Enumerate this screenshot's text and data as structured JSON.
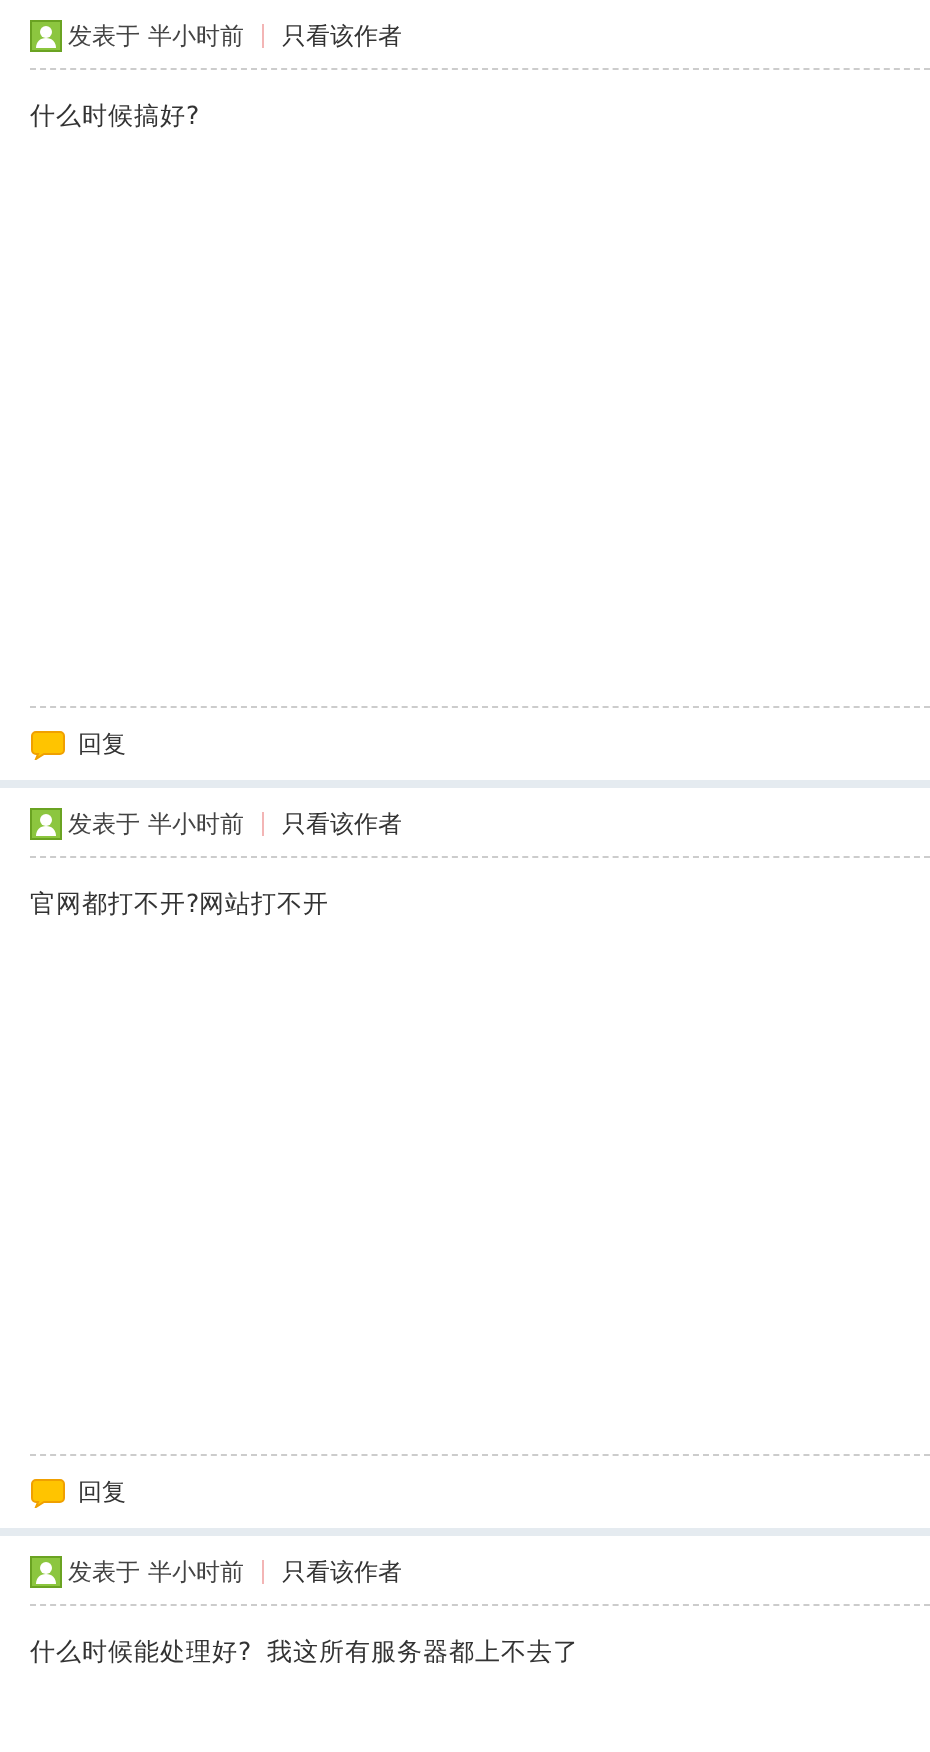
{
  "posts": [
    {
      "posted_label": "发表于",
      "time": "半小时前",
      "author_only_link": "只看该作者",
      "content": "什么时候搞好?",
      "reply_link": "回复"
    },
    {
      "posted_label": "发表于",
      "time": "半小时前",
      "author_only_link": "只看该作者",
      "content": "官网都打不开?网站打不开",
      "reply_link": "回复"
    },
    {
      "posted_label": "发表于",
      "time": "半小时前",
      "author_only_link": "只看该作者",
      "content": "什么时候能处理好?  我这所有服务器都上不去了"
    }
  ]
}
